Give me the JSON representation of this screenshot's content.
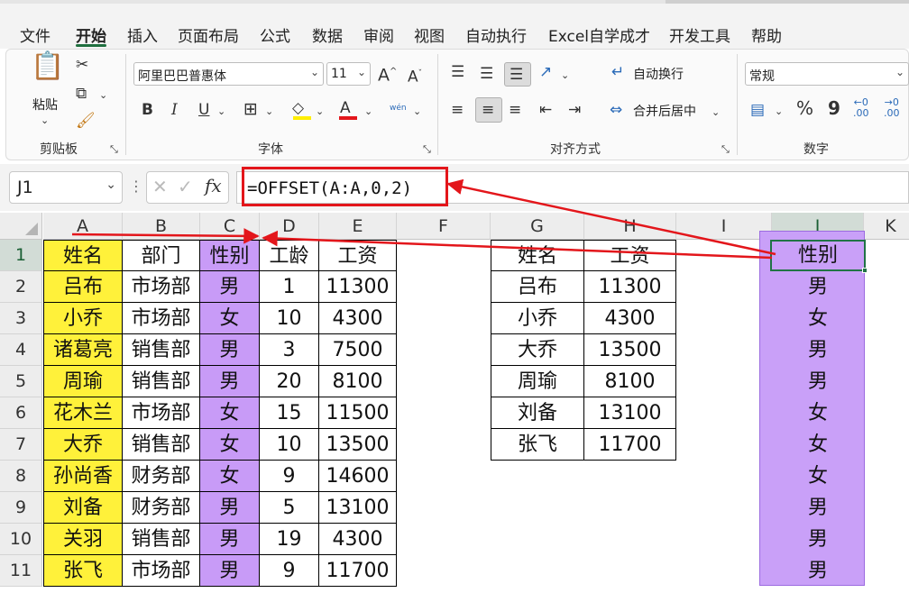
{
  "menu": {
    "items": [
      "文件",
      "开始",
      "插入",
      "页面布局",
      "公式",
      "数据",
      "审阅",
      "视图",
      "自动执行",
      "Excel自学成才",
      "开发工具",
      "帮助"
    ],
    "active_index": 1
  },
  "ribbon": {
    "clipboard": {
      "paste_label": "粘贴",
      "group_label": "剪贴板"
    },
    "font": {
      "font_name": "阿里巴巴普惠体",
      "font_size": "11",
      "bold": "B",
      "italic": "I",
      "underline": "U",
      "grow": "A^",
      "shrink": "A",
      "phonetic": "wén",
      "font_color_letter": "A",
      "group_label": "字体"
    },
    "alignment": {
      "wrap_text": "自动换行",
      "merge_center": "合并后居中",
      "group_label": "对齐方式"
    },
    "number": {
      "format": "常规",
      "percent": "%",
      "comma": "9",
      "dec_inc": "←0\n.00",
      "dec_dec": "→0\n.00",
      "group_label": "数字"
    }
  },
  "formula_bar": {
    "name_box": "J1",
    "formula": "=OFFSET(A:A,0,2)",
    "fx_label": "fx"
  },
  "columns": [
    "A",
    "B",
    "C",
    "D",
    "E",
    "F",
    "G",
    "H",
    "I",
    "J",
    "K"
  ],
  "rows": [
    "1",
    "2",
    "3",
    "4",
    "5",
    "6",
    "7",
    "8",
    "9",
    "10",
    "11"
  ],
  "table1": {
    "headers": [
      "姓名",
      "部门",
      "性别",
      "工龄",
      "工资"
    ],
    "rows": [
      [
        "吕布",
        "市场部",
        "男",
        "1",
        "11300"
      ],
      [
        "小乔",
        "市场部",
        "女",
        "10",
        "4300"
      ],
      [
        "诸葛亮",
        "销售部",
        "男",
        "3",
        "7500"
      ],
      [
        "周瑜",
        "销售部",
        "男",
        "20",
        "8100"
      ],
      [
        "花木兰",
        "市场部",
        "女",
        "15",
        "11500"
      ],
      [
        "大乔",
        "销售部",
        "女",
        "10",
        "13500"
      ],
      [
        "孙尚香",
        "财务部",
        "女",
        "9",
        "14600"
      ],
      [
        "刘备",
        "财务部",
        "男",
        "5",
        "13100"
      ],
      [
        "关羽",
        "销售部",
        "男",
        "19",
        "4300"
      ],
      [
        "张飞",
        "市场部",
        "男",
        "9",
        "11700"
      ]
    ]
  },
  "table2": {
    "headers": [
      "姓名",
      "工资"
    ],
    "rows": [
      [
        "吕布",
        "11300"
      ],
      [
        "小乔",
        "4300"
      ],
      [
        "大乔",
        "13500"
      ],
      [
        "周瑜",
        "8100"
      ],
      [
        "刘备",
        "13100"
      ],
      [
        "张飞",
        "11700"
      ]
    ]
  },
  "col_j": {
    "header": "性别",
    "values": [
      "男",
      "女",
      "男",
      "男",
      "女",
      "女",
      "女",
      "男",
      "男",
      "男"
    ]
  },
  "colors": {
    "highlight_yellow": "#fff13a",
    "highlight_purple": "#c89bf7",
    "annotation_red": "#e3161b",
    "excel_green": "#217346"
  }
}
